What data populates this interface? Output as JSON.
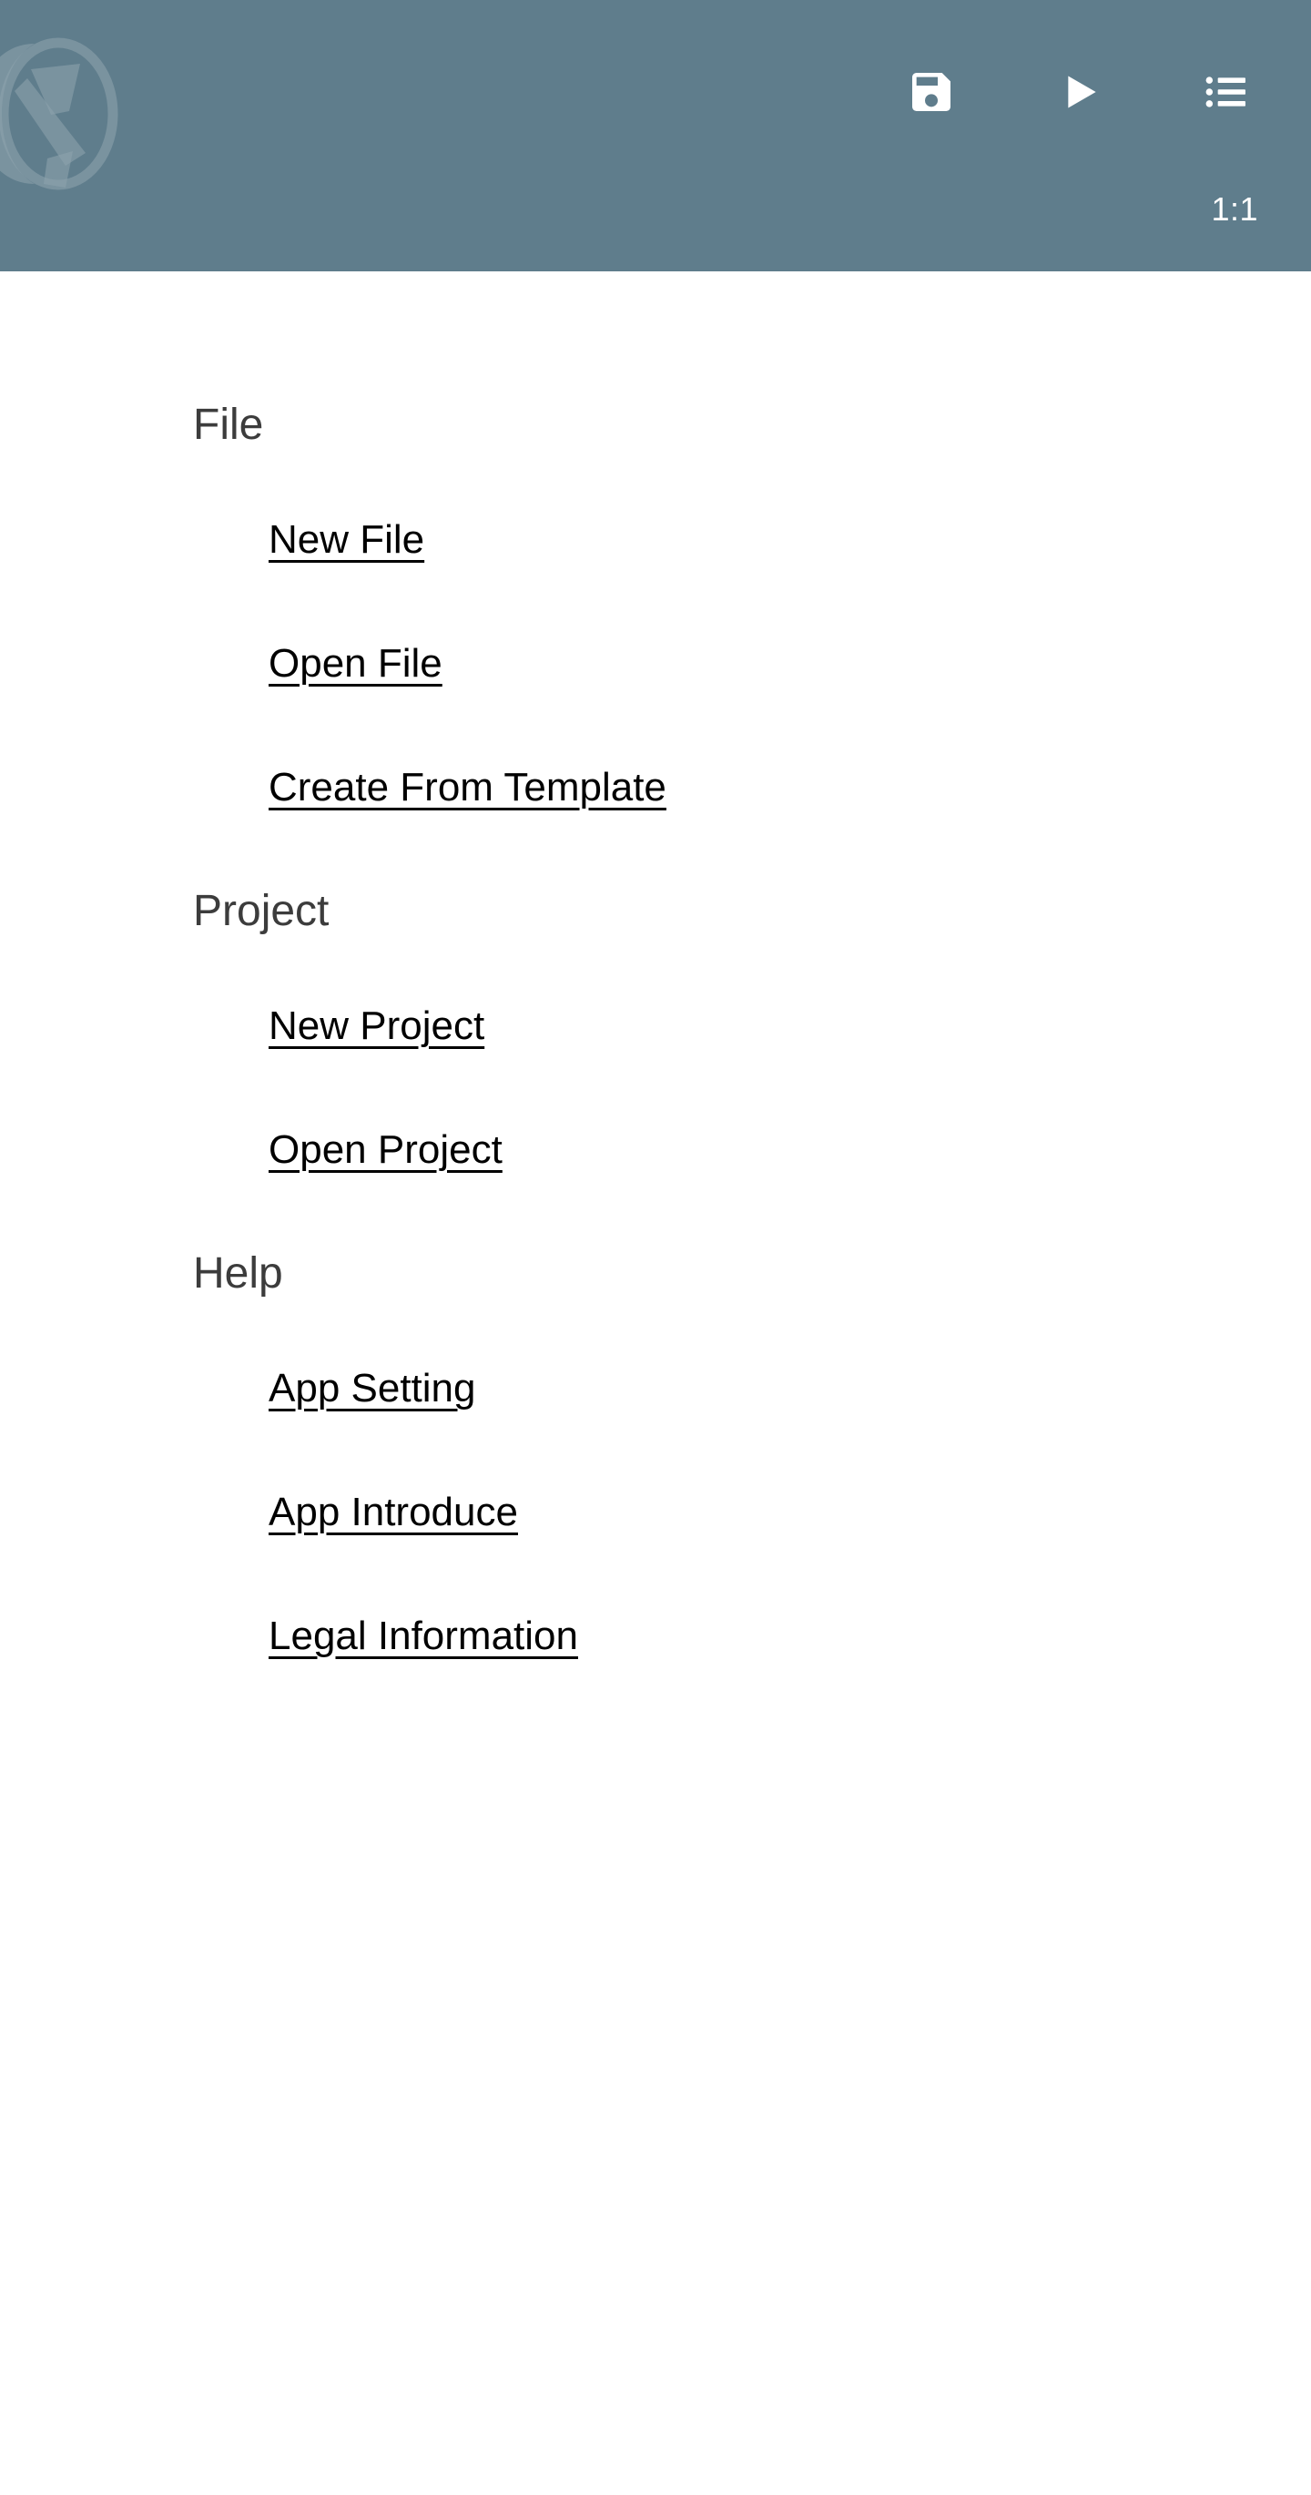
{
  "appbar": {
    "background_color": "#5F7D8C",
    "logo": {
      "icon": "app-logo-watermark",
      "alt": ""
    },
    "actions": [
      {
        "icon": "save-icon",
        "label": "Save"
      },
      {
        "icon": "play-icon",
        "label": "Run"
      },
      {
        "icon": "list-icon",
        "label": "Menu"
      }
    ],
    "ratio_label": "1:1"
  },
  "menu": {
    "sections": [
      {
        "title": "File",
        "items": [
          {
            "label": "New File"
          },
          {
            "label": "Open File"
          },
          {
            "label": "Create From Template"
          }
        ]
      },
      {
        "title": "Project",
        "items": [
          {
            "label": "New Project"
          },
          {
            "label": "Open Project"
          }
        ]
      },
      {
        "title": "Help",
        "items": [
          {
            "label": "App Setting"
          },
          {
            "label": "App Introduce"
          },
          {
            "label": "Legal Information"
          }
        ]
      }
    ]
  },
  "colors": {
    "appbar": "#5F7D8C",
    "page_background": "#FFFFFF",
    "section_title": "#3C3C3C",
    "item_text": "#000000",
    "icon": "#FFFFFF"
  }
}
